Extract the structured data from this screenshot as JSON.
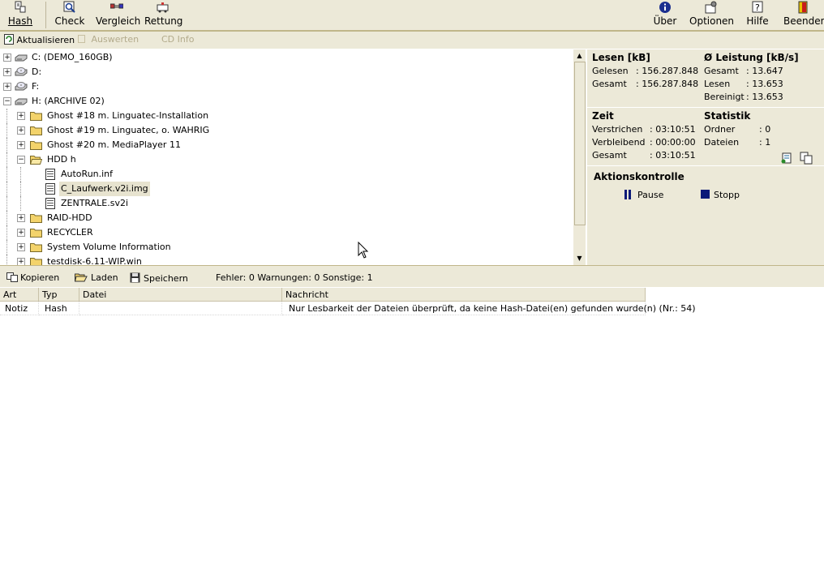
{
  "toolbar": {
    "hash_label": "Hash",
    "check_label": "Check",
    "vergleich_label": "Vergleich",
    "rettung_label": "Rettung",
    "ueber_label": "Über",
    "optionen_label": "Optionen",
    "hilfe_label": "Hilfe",
    "beenden_label": "Beenden"
  },
  "subbar": {
    "aktualisieren": "Aktualisieren",
    "auswerten": "Auswerten",
    "cd_info": "CD Info"
  },
  "tree": {
    "items": [
      {
        "label": "C: (DEMO_160GB)",
        "type": "drive",
        "expander": "+"
      },
      {
        "label": "D:",
        "type": "cdrom",
        "expander": "+"
      },
      {
        "label": "F:",
        "type": "cdrom",
        "expander": "+"
      },
      {
        "label": "H: (ARCHIVE 02)",
        "type": "drive",
        "expander": "−"
      },
      {
        "label": "Ghost #18 m. Linguatec-Installation",
        "type": "folder",
        "expander": "+"
      },
      {
        "label": "Ghost #19 m. Linguatec, o. WAHRIG",
        "type": "folder",
        "expander": "+"
      },
      {
        "label": "Ghost #20 m. MediaPlayer 11",
        "type": "folder",
        "expander": "+"
      },
      {
        "label": "HDD h",
        "type": "folder-open",
        "expander": "−"
      },
      {
        "label": "AutoRun.inf",
        "type": "file"
      },
      {
        "label": "C_Laufwerk.v2i.img",
        "type": "file",
        "selected": true
      },
      {
        "label": "ZENTRALE.sv2i",
        "type": "file"
      },
      {
        "label": "RAID-HDD",
        "type": "folder",
        "expander": "+"
      },
      {
        "label": "RECYCLER",
        "type": "folder",
        "expander": "+"
      },
      {
        "label": "System Volume Information",
        "type": "folder",
        "expander": "+"
      },
      {
        "label": "testdisk-6.11-WIP.win",
        "type": "folder",
        "expander": "+"
      }
    ]
  },
  "stats": {
    "lesen_title": "Lesen [kB]",
    "gelesen_label": "Gelesen",
    "gelesen_value": ": 156.287.848",
    "gesamt_label": "Gesamt",
    "gesamt_value": ": 156.287.848",
    "leistung_title": "Ø Leistung [kB/s]",
    "l_gesamt_label": "Gesamt",
    "l_gesamt_value": ": 13.647",
    "l_lesen_label": "Lesen",
    "l_lesen_value": ": 13.653",
    "l_bereinigt_label": "Bereinigt",
    "l_bereinigt_value": ": 13.653",
    "zeit_title": "Zeit",
    "verstrichen_label": "Verstrichen",
    "verstrichen_value": ": 03:10:51",
    "verbleibend_label": "Verbleibend",
    "verbleibend_value": ": 00:00:00",
    "z_gesamt_label": "Gesamt",
    "z_gesamt_value": ": 03:10:51",
    "statistik_title": "Statistik",
    "ordner_label": "Ordner",
    "ordner_value": ": 0",
    "dateien_label": "Dateien",
    "dateien_value": ": 1",
    "aktionskontrolle_title": "Aktionskontrolle",
    "pause_label": "Pause",
    "stopp_label": "Stopp"
  },
  "logbar": {
    "kopieren": "Kopieren",
    "laden": "Laden",
    "speichern": "Speichern",
    "summary": "Fehler: 0 Warnungen: 0 Sonstige: 1"
  },
  "log": {
    "columns": [
      "Art",
      "Typ",
      "Datei",
      "Nachricht"
    ],
    "rows": [
      {
        "art": "Notiz",
        "typ": "Hash",
        "datei": "",
        "nachricht": "Nur Lesbarkeit der Dateien überprüft, da keine Hash-Datei(en) gefunden wurde(n) (Nr.: 54)"
      }
    ]
  },
  "colors": {
    "chrome": "#ece9d8",
    "pause_icon": "#0b1a78",
    "stop_icon": "#0b1a78",
    "folder": "#f3d36b"
  }
}
